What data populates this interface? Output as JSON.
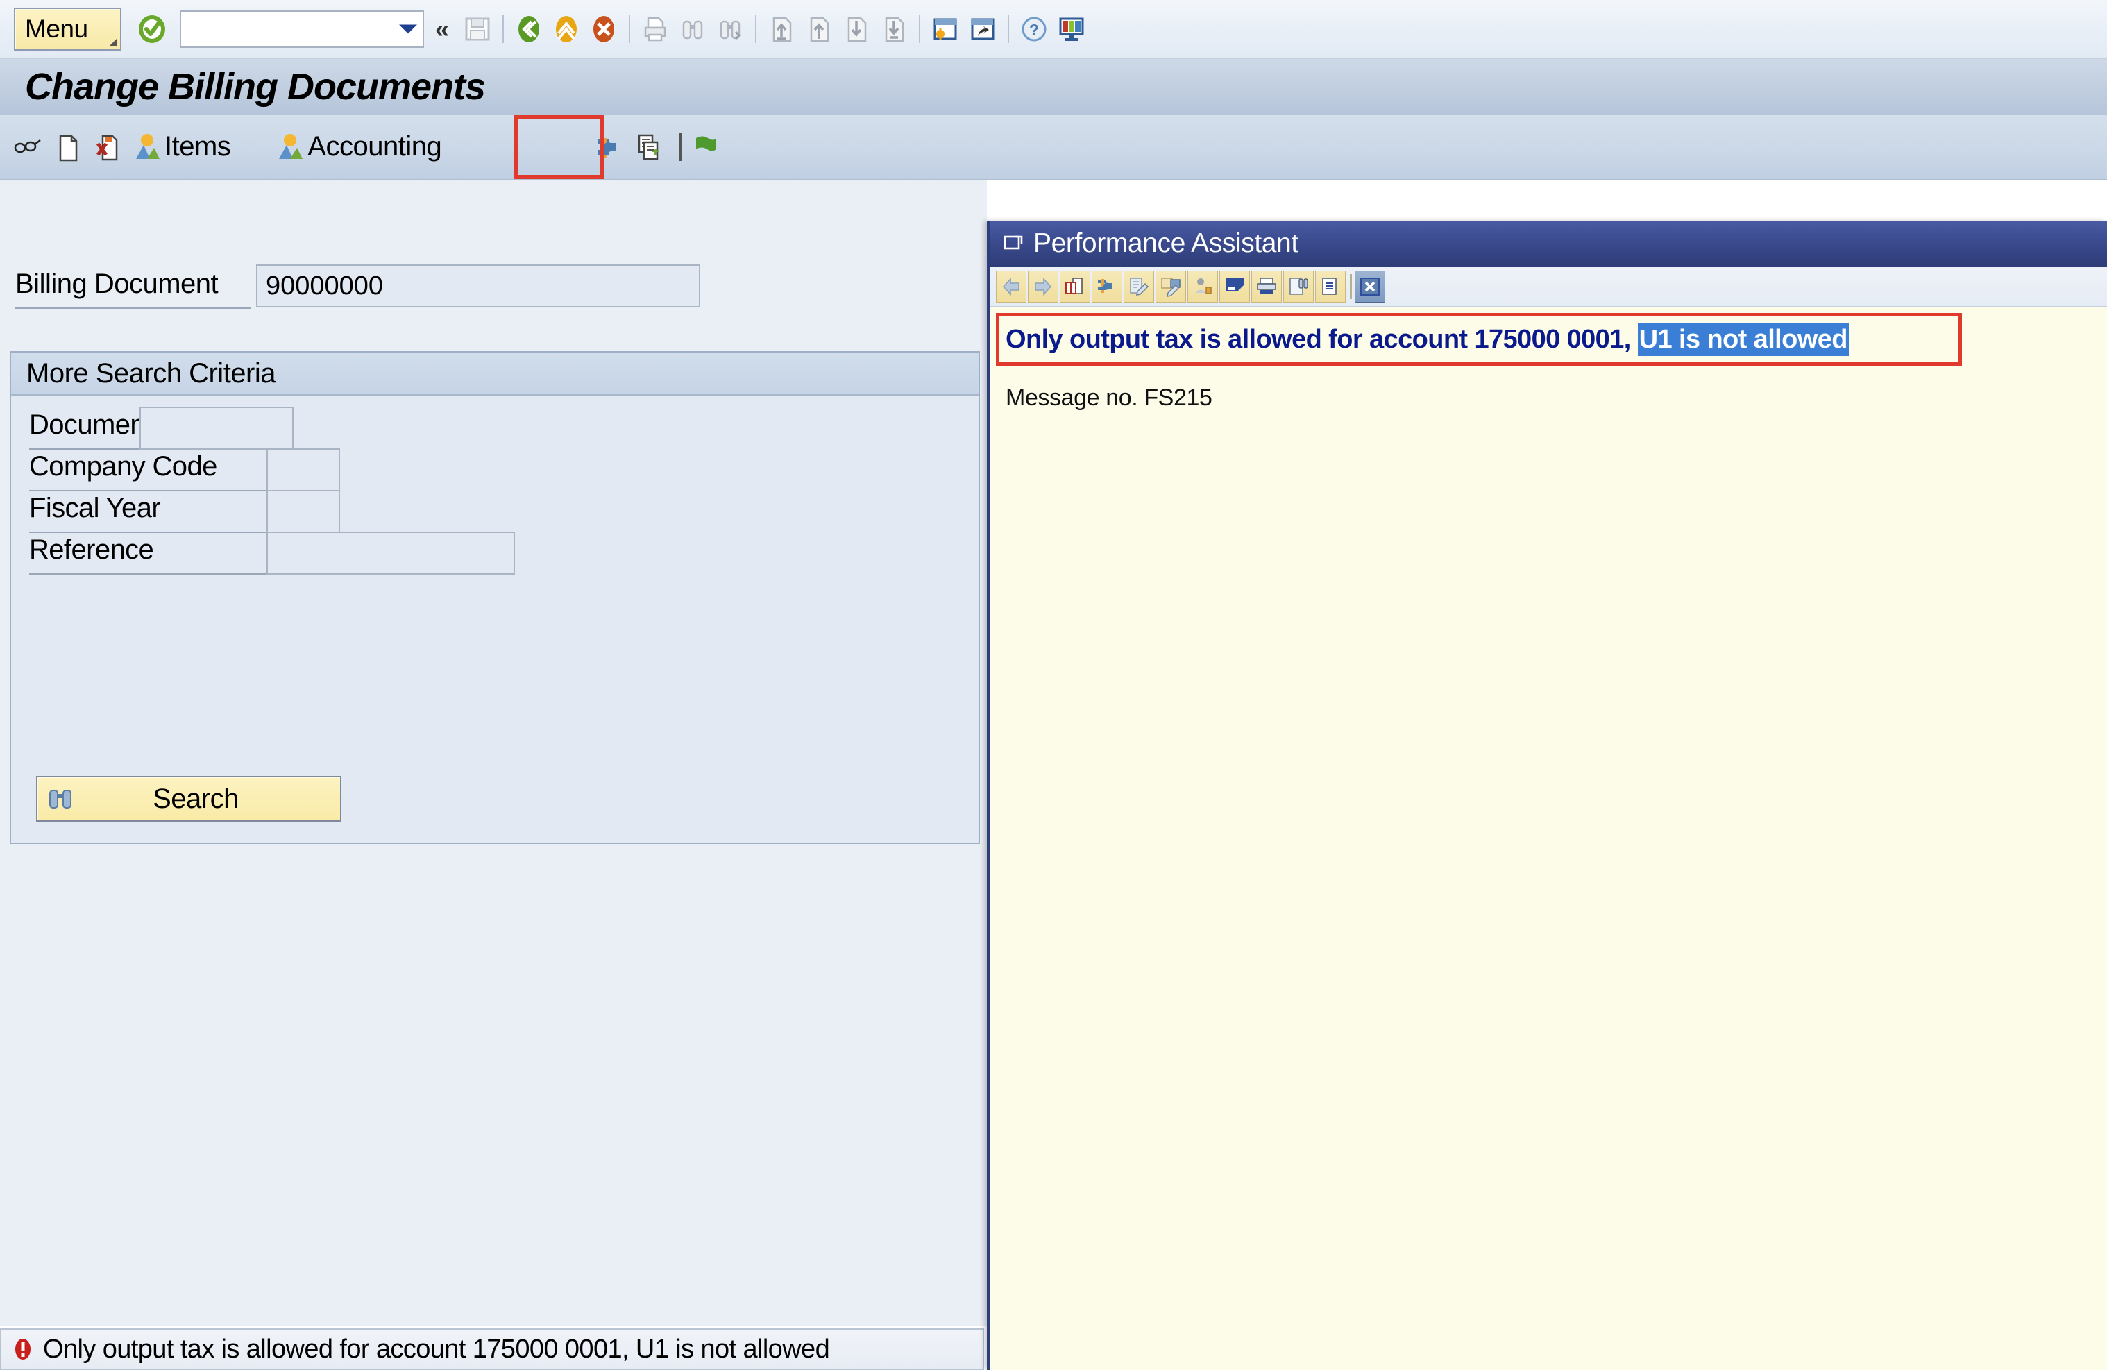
{
  "system_toolbar": {
    "menu_label": "Menu",
    "command_field": {
      "value": "",
      "placeholder": ""
    },
    "icons": [
      {
        "name": "enter-check-icon",
        "title": "Enter"
      },
      {
        "name": "save-icon",
        "title": "Save"
      },
      {
        "name": "back-green-icon",
        "title": "Back"
      },
      {
        "name": "exit-yellow-icon",
        "title": "Exit"
      },
      {
        "name": "cancel-red-icon",
        "title": "Cancel"
      },
      {
        "name": "print-icon",
        "title": "Print"
      },
      {
        "name": "find-icon",
        "title": "Find"
      },
      {
        "name": "find-next-icon",
        "title": "Find Next"
      },
      {
        "name": "first-page-icon",
        "title": "First Page"
      },
      {
        "name": "previous-page-icon",
        "title": "Previous Page"
      },
      {
        "name": "next-page-icon",
        "title": "Next Page"
      },
      {
        "name": "last-page-icon",
        "title": "Last Page"
      },
      {
        "name": "create-session-icon",
        "title": "Create New Session"
      },
      {
        "name": "create-shortcut-icon",
        "title": "Create Shortcut"
      },
      {
        "name": "help-icon",
        "title": "Help"
      },
      {
        "name": "customize-layout-icon",
        "title": "Customize Local Layout"
      }
    ],
    "collapse_label": "«"
  },
  "title_bar": {
    "title": "Change Billing Documents"
  },
  "app_toolbar": {
    "buttons": [
      {
        "name": "display-change-button",
        "label": "",
        "icon": "glasses-pencil-icon"
      },
      {
        "name": "new-document-button",
        "label": "",
        "icon": "blank-page-icon"
      },
      {
        "name": "cancel-document-button",
        "label": "",
        "icon": "document-delete-icon"
      },
      {
        "name": "items-button",
        "label": "Items",
        "icon": "overview-icon"
      },
      {
        "name": "accounting-button",
        "label": "Accounting",
        "icon": "overview-icon"
      },
      {
        "name": "settings-button",
        "label": "",
        "icon": "hammer-wrench-icon"
      },
      {
        "name": "copy-document-button",
        "label": "",
        "icon": "documents-copy-icon"
      },
      {
        "name": "release-flag-button",
        "label": "",
        "icon": "green-flag-icon"
      }
    ],
    "highlighted_button": "release-flag-button"
  },
  "main_form": {
    "billing_document": {
      "label": "Billing Document",
      "value": "90000000",
      "placeholder": ""
    },
    "criteria_group": {
      "title": "More Search Criteria",
      "fields": [
        {
          "name": "document-number",
          "label": "Document Numbe",
          "value": "",
          "placeholder": ""
        },
        {
          "name": "company-code",
          "label": "Company Code",
          "value": "",
          "placeholder": ""
        },
        {
          "name": "fiscal-year",
          "label": "Fiscal Year",
          "value": "",
          "placeholder": ""
        },
        {
          "name": "reference",
          "label": "Reference",
          "value": "",
          "placeholder": ""
        }
      ],
      "search_button_label": "Search"
    }
  },
  "status_bar": {
    "message": "Only output tax is allowed for account 175000 0001, U1 is not allowed",
    "icon": "error-icon"
  },
  "performance_assistant": {
    "title": "Performance Assistant",
    "toolbar_buttons": [
      {
        "name": "back-arrow-icon",
        "title": "Back"
      },
      {
        "name": "forward-arrow-icon",
        "title": "Forward"
      },
      {
        "name": "glossary-book-icon",
        "title": "Glossary"
      },
      {
        "name": "technical-info-icon",
        "title": "Technical Information"
      },
      {
        "name": "note-edit-icon",
        "title": "Create Note"
      },
      {
        "name": "note-edit-alt-icon",
        "title": "Edit Note"
      },
      {
        "name": "customizing-icon",
        "title": "Customizing"
      },
      {
        "name": "application-help-icon",
        "title": "Application Help"
      },
      {
        "name": "print-icon",
        "title": "Print"
      },
      {
        "name": "search-document-icon",
        "title": "Find"
      },
      {
        "name": "copy-text-icon",
        "title": "Copy Text"
      },
      {
        "name": "close-icon",
        "title": "Close"
      }
    ],
    "message_prefix": "Only output tax is allowed for account 175000 0001, ",
    "message_selected": "U1 is not allowed",
    "message_number": "Message no. FS215"
  },
  "colors": {
    "highlight_red": "#e03a2f",
    "selection_blue": "#3a7fd5",
    "message_blue": "#0a1a8c",
    "dialog_bg": "#fcfce8",
    "title_bar_blue": "#2e3c77",
    "button_yellow": "#f8e9a8"
  }
}
